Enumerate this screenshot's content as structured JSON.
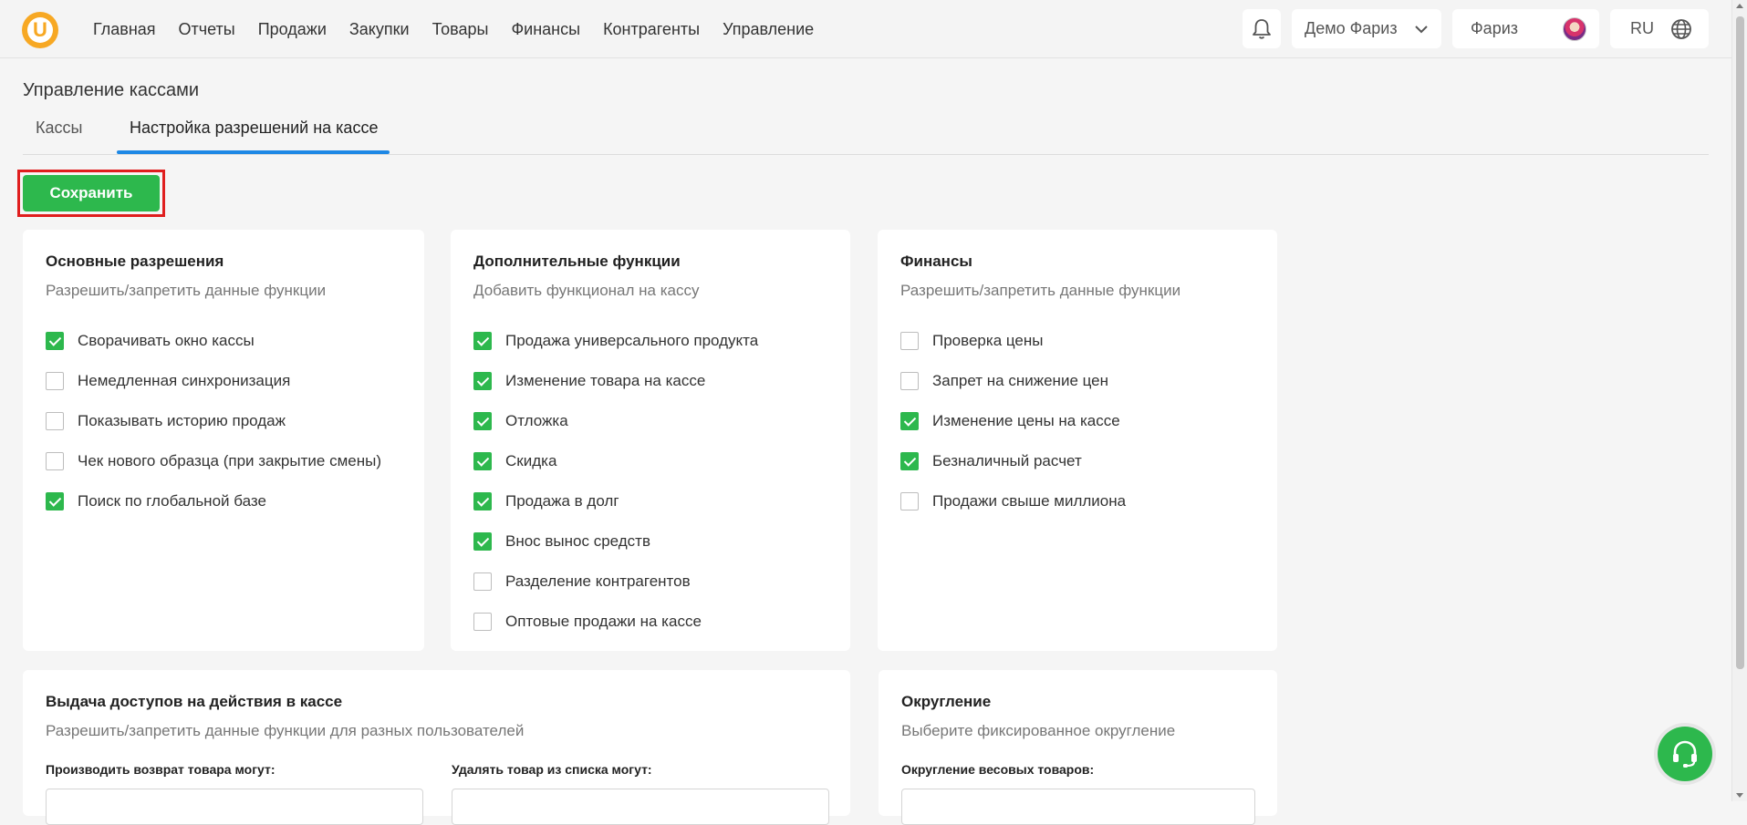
{
  "header": {
    "logo_letter": "U",
    "nav": [
      "Главная",
      "Отчеты",
      "Продажи",
      "Закупки",
      "Товары",
      "Финансы",
      "Контрагенты",
      "Управление"
    ],
    "company": "Демо Фариз",
    "user": "Фариз",
    "lang": "RU"
  },
  "page": {
    "title": "Управление кассами",
    "tabs": [
      "Кассы",
      "Настройка разрешений на кассе"
    ],
    "active_tab": 1,
    "save_label": "Сохранить"
  },
  "cards": {
    "basic": {
      "title": "Основные разрешения",
      "subtitle": "Разрешить/запретить данные функции",
      "options": [
        {
          "label": "Сворачивать окно кассы",
          "checked": true
        },
        {
          "label": "Немедленная синхронизация",
          "checked": false
        },
        {
          "label": "Показывать историю продаж",
          "checked": false
        },
        {
          "label": "Чек нового образца (при закрытие смены)",
          "checked": false
        },
        {
          "label": "Поиск по глобальной базе",
          "checked": true
        }
      ]
    },
    "extra": {
      "title": "Дополнительные функции",
      "subtitle": "Добавить функционал на кассу",
      "options": [
        {
          "label": "Продажа универсального продукта",
          "checked": true
        },
        {
          "label": "Изменение товара на кассе",
          "checked": true
        },
        {
          "label": "Отложка",
          "checked": true
        },
        {
          "label": "Скидка",
          "checked": true
        },
        {
          "label": "Продажа в долг",
          "checked": true
        },
        {
          "label": "Внос вынос средств",
          "checked": true
        },
        {
          "label": "Разделение контрагентов",
          "checked": false
        },
        {
          "label": "Оптовые продажи на кассе",
          "checked": false
        }
      ]
    },
    "finance": {
      "title": "Финансы",
      "subtitle": "Разрешить/запретить данные функции",
      "options": [
        {
          "label": "Проверка цены",
          "checked": false
        },
        {
          "label": "Запрет на снижение цен",
          "checked": false
        },
        {
          "label": "Изменение цены на кассе",
          "checked": true
        },
        {
          "label": "Безналичный расчет",
          "checked": true
        },
        {
          "label": "Продажи свыше миллиона",
          "checked": false
        }
      ]
    },
    "access": {
      "title": "Выдача доступов на действия в кассе",
      "subtitle": "Разрешить/запретить данные функции для разных пользователей",
      "field_return": "Производить возврат товара могут:",
      "field_delete": "Удалять товар из списка могут:"
    },
    "rounding": {
      "title": "Округление",
      "subtitle": "Выберите фиксированное округление",
      "field_weight": "Округление весовых товаров:"
    }
  },
  "colors": {
    "accent_green": "#2db84d",
    "tab_blue": "#1e88e5",
    "highlight_red": "#e01e1e",
    "logo_orange": "#f7a823"
  }
}
